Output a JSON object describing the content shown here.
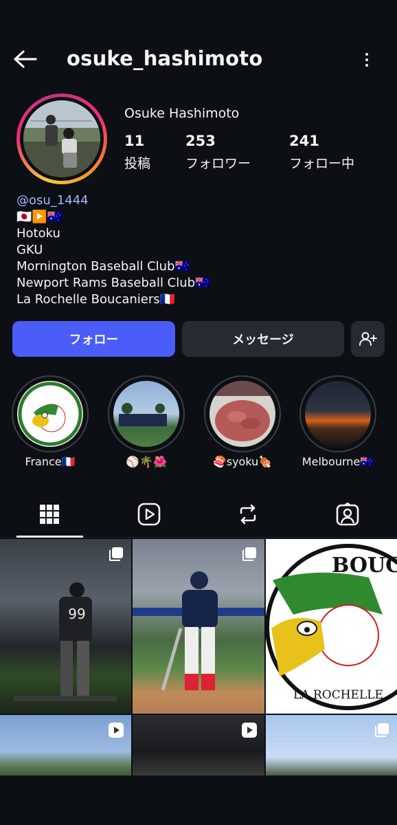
{
  "header": {
    "username": "osuke_hashimoto"
  },
  "profile": {
    "full_name": "Osuke Hashimoto",
    "stats": [
      {
        "value": "11",
        "label": "投稿"
      },
      {
        "value": "253",
        "label": "フォロワー"
      },
      {
        "value": "241",
        "label": "フォロー中"
      }
    ],
    "threads_handle": "osu_1444",
    "bio_lines": [
      "🇯🇵▶️🇦🇺",
      "Hotoku",
      "GKU",
      "Mornington Baseball Club🇦🇺",
      "Newport Rams Baseball Club🇦🇺",
      "La Rochelle Boucaniers🇫🇷"
    ]
  },
  "actions": {
    "follow_label": "フォロー",
    "message_label": "メッセージ",
    "add_user_icon": "add-person-icon"
  },
  "highlights": [
    {
      "label": "France🇫🇷"
    },
    {
      "label": "⚾️🌴🌺"
    },
    {
      "label": "🍣syoku🍖"
    },
    {
      "label": "Melbourne🇦🇺"
    }
  ],
  "tabs": [
    {
      "icon": "grid-icon",
      "active": true
    },
    {
      "icon": "reels-icon",
      "active": false
    },
    {
      "icon": "repost-icon",
      "active": false
    },
    {
      "icon": "tagged-icon",
      "active": false
    }
  ],
  "grid_posts": [
    {
      "type": "carousel",
      "subject": "player #99 at night",
      "jersey": "99"
    },
    {
      "type": "carousel",
      "subject": "batter running"
    },
    {
      "type": "image",
      "subject": "Boucaniers logo",
      "logo_top": "BOUCANIERS",
      "logo_bottom": "LA ROCHELLE"
    },
    {
      "type": "reel",
      "subject": "sky landscape"
    },
    {
      "type": "reel",
      "subject": "dark close-up"
    },
    {
      "type": "carousel",
      "subject": "sky landscape"
    }
  ],
  "colors": {
    "background": "#0c0f14",
    "follow_button": "#4a5df9",
    "secondary_button": "#262a31",
    "link": "#a7b5ff"
  }
}
